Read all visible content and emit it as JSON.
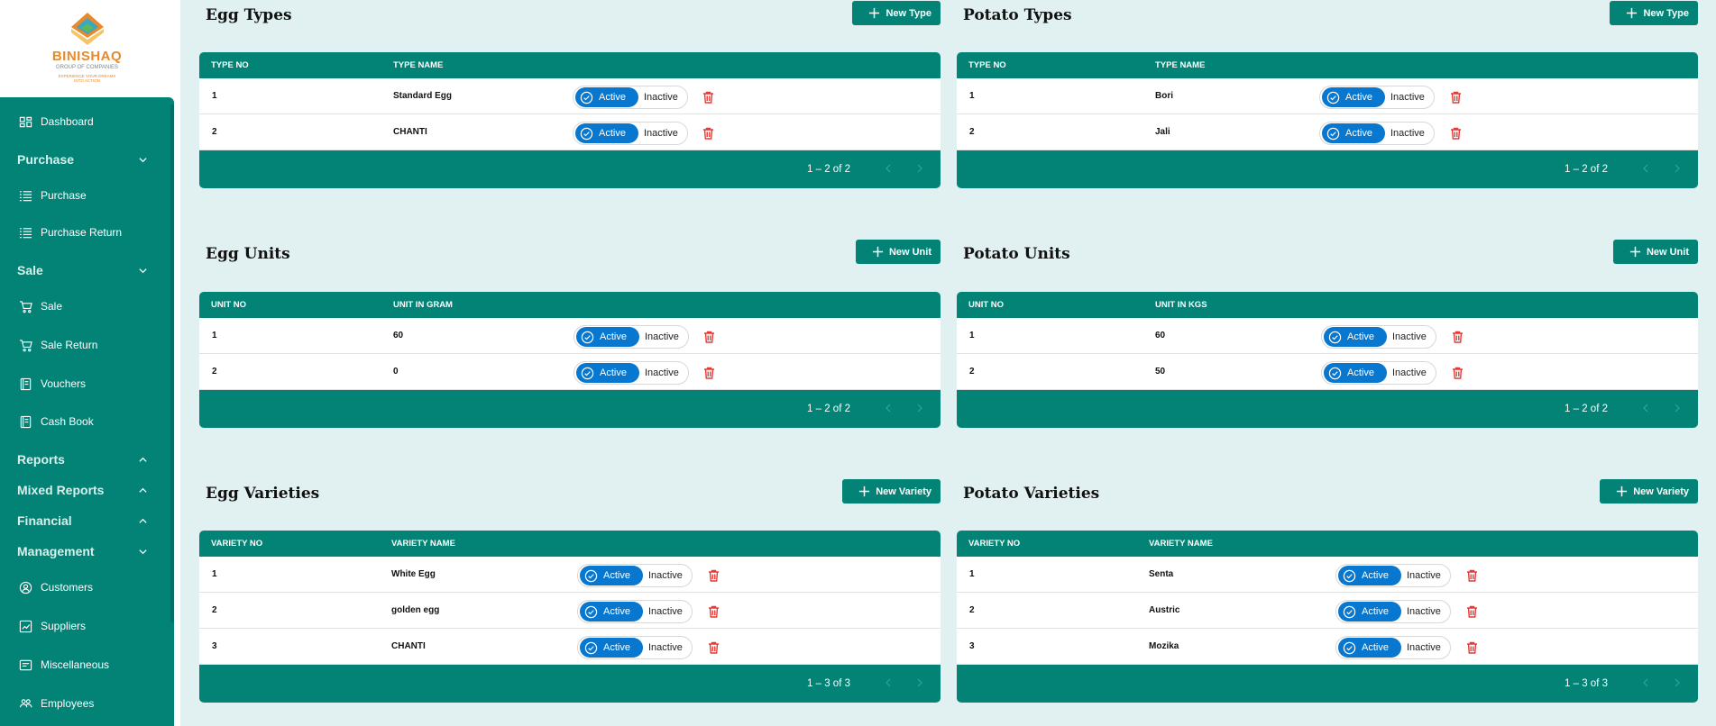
{
  "brand": {
    "name": "BINISHAQ",
    "subtitle": "GROUP OF COMPANIES",
    "tagline_line1": "EXPERIENCE YOUR DREAMS",
    "tagline_line2": "INTO ACTION"
  },
  "sidebar": {
    "items": [
      {
        "type": "item",
        "label": "Dashboard",
        "icon": "dashboard-icon"
      },
      {
        "type": "section",
        "label": "Purchase",
        "chevron": "down"
      },
      {
        "type": "item",
        "label": "Purchase",
        "icon": "list-icon"
      },
      {
        "type": "item",
        "label": "Purchase Return",
        "icon": "list-icon"
      },
      {
        "type": "section",
        "label": "Sale",
        "chevron": "down"
      },
      {
        "type": "item",
        "label": "Sale",
        "icon": "cart-icon"
      },
      {
        "type": "item",
        "label": "Sale Return",
        "icon": "cart-icon"
      },
      {
        "type": "item",
        "label": "Vouchers",
        "icon": "book-icon"
      },
      {
        "type": "item",
        "label": "Cash Book",
        "icon": "book-icon"
      },
      {
        "type": "section",
        "label": "Reports",
        "chevron": "up"
      },
      {
        "type": "section",
        "label": "Mixed Reports",
        "chevron": "up"
      },
      {
        "type": "section",
        "label": "Financial",
        "chevron": "up"
      },
      {
        "type": "section",
        "label": "Management",
        "chevron": "down"
      },
      {
        "type": "item",
        "label": "Customers",
        "icon": "customer-icon"
      },
      {
        "type": "item",
        "label": "Suppliers",
        "icon": "chart-icon"
      },
      {
        "type": "item",
        "label": "Miscellaneous",
        "icon": "misc-icon"
      },
      {
        "type": "item",
        "label": "Employees",
        "icon": "people-icon"
      }
    ]
  },
  "toggle": {
    "active_label": "Active",
    "inactive_label": "Inactive"
  },
  "panels": {
    "egg_types": {
      "title": "Egg Types",
      "button": "New Type",
      "columns": [
        "TYPE NO",
        "TYPE NAME"
      ],
      "rows": [
        {
          "no": "1",
          "name": "Standard Egg"
        },
        {
          "no": "2",
          "name": "CHANTI"
        }
      ],
      "range": "1 – 2 of 2"
    },
    "potato_types": {
      "title": "Potato Types",
      "button": "New Type",
      "columns": [
        "TYPE NO",
        "TYPE NAME"
      ],
      "rows": [
        {
          "no": "1",
          "name": "Bori"
        },
        {
          "no": "2",
          "name": "Jali"
        }
      ],
      "range": "1 – 2 of 2"
    },
    "egg_units": {
      "title": "Egg Units",
      "button": "New Unit",
      "columns": [
        "UNIT NO",
        "UNIT IN GRAM"
      ],
      "rows": [
        {
          "no": "1",
          "name": "60"
        },
        {
          "no": "2",
          "name": "0"
        }
      ],
      "range": "1 – 2 of 2"
    },
    "potato_units": {
      "title": "Potato Units",
      "button": "New Unit",
      "columns": [
        "UNIT NO",
        "UNIT IN KGS"
      ],
      "rows": [
        {
          "no": "1",
          "name": "60"
        },
        {
          "no": "2",
          "name": "50"
        }
      ],
      "range": "1 – 2 of 2"
    },
    "egg_varieties": {
      "title": "Egg Varieties",
      "button": "New Variety",
      "columns": [
        "VARIETY NO",
        "VARIETY NAME"
      ],
      "rows": [
        {
          "no": "1",
          "name": "White Egg"
        },
        {
          "no": "2",
          "name": "golden egg"
        },
        {
          "no": "3",
          "name": "CHANTI"
        }
      ],
      "range": "1 – 3 of 3"
    },
    "potato_varieties": {
      "title": "Potato Varieties",
      "button": "New Variety",
      "columns": [
        "VARIETY NO",
        "VARIETY NAME"
      ],
      "rows": [
        {
          "no": "1",
          "name": "Senta"
        },
        {
          "no": "2",
          "name": "Austric"
        },
        {
          "no": "3",
          "name": "Mozika"
        }
      ],
      "range": "1 – 3 of 3"
    }
  },
  "colors": {
    "teal": "#028376",
    "active_blue": "#0777cf",
    "delete_red": "#e53935",
    "page_bg": "#e1f1f1",
    "brand_orange": "#e8892a"
  }
}
